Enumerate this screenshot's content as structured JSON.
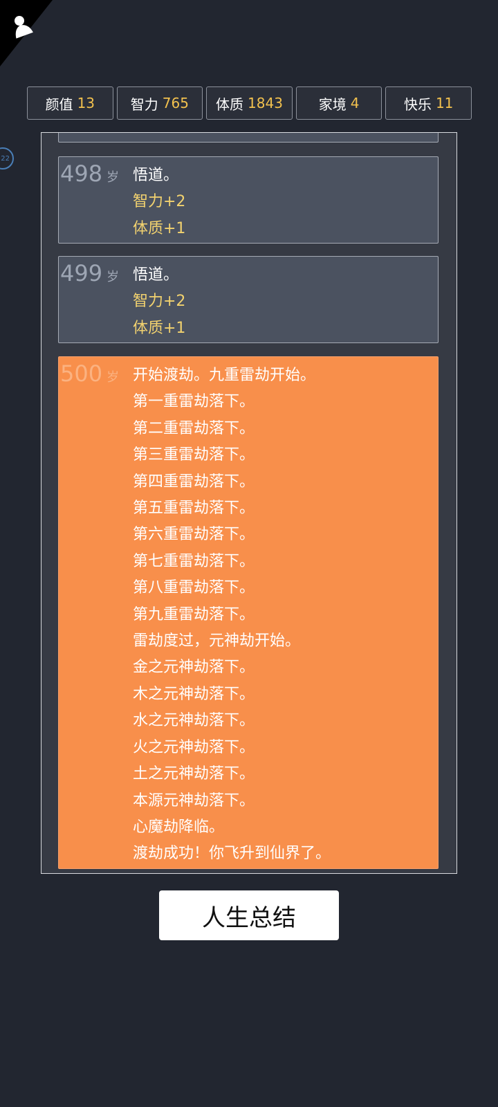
{
  "stats": [
    {
      "label": "颜值",
      "value": "13"
    },
    {
      "label": "智力",
      "value": "765"
    },
    {
      "label": "体质",
      "value": "1843"
    },
    {
      "label": "家境",
      "value": "4"
    },
    {
      "label": "快乐",
      "value": "11"
    }
  ],
  "side_badge": "22",
  "age_unit": "岁",
  "entries": [
    {
      "age": "498",
      "lines": [
        "悟道。",
        "智力+2",
        "体质+1"
      ]
    },
    {
      "age": "499",
      "lines": [
        "悟道。",
        "智力+2",
        "体质+1"
      ]
    },
    {
      "age": "500",
      "lines": [
        "开始渡劫。九重雷劫开始。",
        "第一重雷劫落下。",
        "第二重雷劫落下。",
        "第三重雷劫落下。",
        "第四重雷劫落下。",
        "第五重雷劫落下。",
        "第六重雷劫落下。",
        "第七重雷劫落下。",
        "第八重雷劫落下。",
        "第九重雷劫落下。",
        "雷劫度过，元神劫开始。",
        "金之元神劫落下。",
        "木之元神劫落下。",
        "水之元神劫落下。",
        "火之元神劫落下。",
        "土之元神劫落下。",
        "本源元神劫落下。",
        "心魔劫降临。",
        "渡劫成功！你飞升到仙界了。"
      ]
    }
  ],
  "summary_button": "人生总结",
  "colors": {
    "background": "#222630",
    "highlight": "#f88f4b",
    "stat_value": "#f2c14e",
    "attribute_text": "#f2d26f"
  }
}
